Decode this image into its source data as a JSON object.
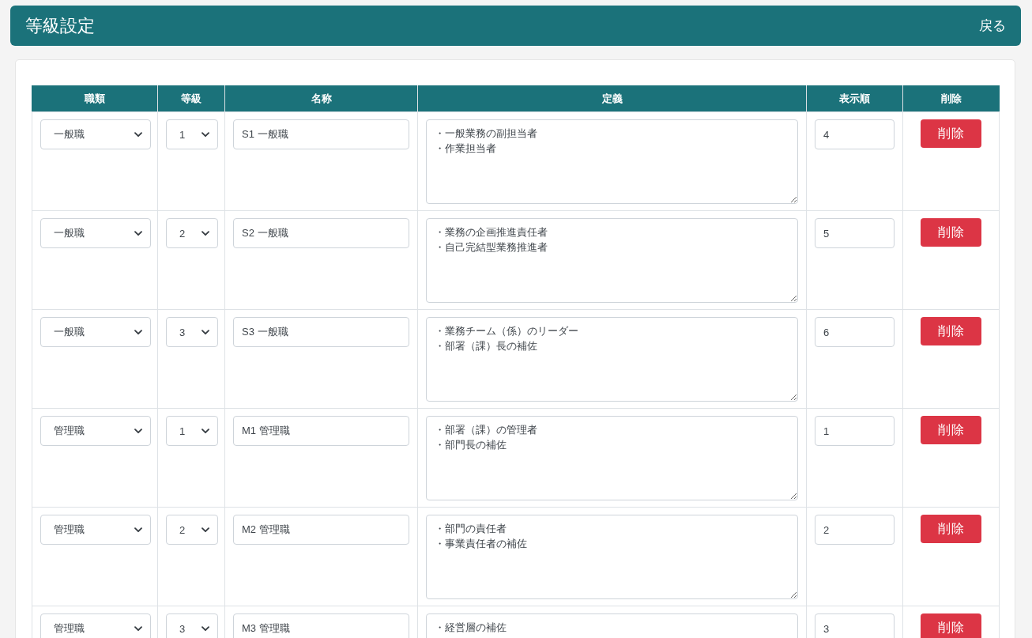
{
  "header": {
    "title": "等級設定",
    "back_link": "戻る"
  },
  "table": {
    "columns": [
      "職類",
      "等級",
      "名称",
      "定義",
      "表示順",
      "削除"
    ],
    "rows": [
      {
        "job_type": "一般職",
        "grade": "1",
        "name": "S1 一般職",
        "definition": [
          "・一般業務の副担当者",
          "・作業担当者"
        ],
        "display_order": "4",
        "delete_label": "削除"
      },
      {
        "job_type": "一般職",
        "grade": "2",
        "name": "S2 一般職",
        "definition": [
          "・業務の企画推進責任者",
          "・自己完結型業務推進者"
        ],
        "display_order": "5",
        "delete_label": "削除"
      },
      {
        "job_type": "一般職",
        "grade": "3",
        "name": "S3 一般職",
        "definition": [
          "・業務チーム（係）のリーダー",
          "・部署（課）長の補佐"
        ],
        "display_order": "6",
        "delete_label": "削除"
      },
      {
        "job_type": "管理職",
        "grade": "1",
        "name": "M1 管理職",
        "definition": [
          "・部署（課）の管理者",
          "・部門長の補佐"
        ],
        "display_order": "1",
        "delete_label": "削除"
      },
      {
        "job_type": "管理職",
        "grade": "2",
        "name": "M2 管理職",
        "definition": [
          "・部門の責任者",
          "・事業責任者の補佐"
        ],
        "display_order": "2",
        "delete_label": "削除"
      },
      {
        "job_type": "管理職",
        "grade": "3",
        "name": "M3 管理職",
        "definition": [
          "・経営層の補佐"
        ],
        "display_order": "3",
        "delete_label": "削除"
      }
    ]
  }
}
